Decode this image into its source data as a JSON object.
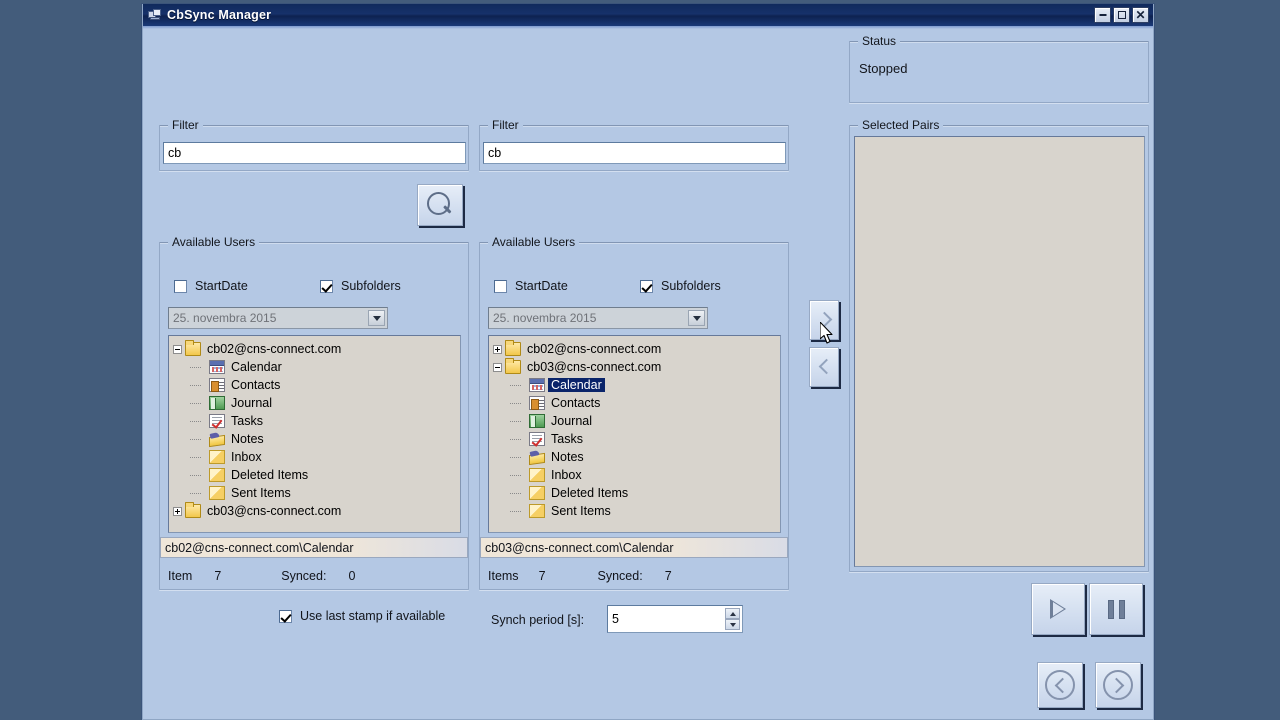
{
  "window": {
    "title": "CbSync Manager",
    "icon": "app-icon",
    "buttons": {
      "minimize": "_",
      "maximize": "□",
      "close": "✕"
    }
  },
  "status": {
    "legend": "Status",
    "value": "Stopped"
  },
  "selected_pairs": {
    "legend": "Selected Pairs",
    "items": []
  },
  "left_panel": {
    "filter": {
      "legend": "Filter",
      "value": "cb",
      "placeholder": ""
    },
    "users": {
      "legend": "Available Users",
      "startdate_label": "StartDate",
      "startdate_checked": false,
      "subfolders_label": "Subfolders",
      "subfolders_checked": true,
      "date_value": "25. novembra 2015",
      "date_enabled": false
    },
    "tree": [
      {
        "label": "cb02@cns-connect.com",
        "icon": "folder-icon",
        "level": 0,
        "expander": "minus",
        "selected": false
      },
      {
        "label": "Calendar",
        "icon": "calendar-icon",
        "level": 1,
        "expander": "none",
        "selected": false
      },
      {
        "label": "Contacts",
        "icon": "contacts-icon",
        "level": 1,
        "expander": "none",
        "selected": false
      },
      {
        "label": "Journal",
        "icon": "journal-icon",
        "level": 1,
        "expander": "none",
        "selected": false
      },
      {
        "label": "Tasks",
        "icon": "tasks-icon",
        "level": 1,
        "expander": "none",
        "selected": false
      },
      {
        "label": "Notes",
        "icon": "notes-icon",
        "level": 1,
        "expander": "none",
        "selected": false
      },
      {
        "label": "Inbox",
        "icon": "folder2-icon",
        "level": 1,
        "expander": "none",
        "selected": false
      },
      {
        "label": "Deleted Items",
        "icon": "folder2-icon",
        "level": 1,
        "expander": "none",
        "selected": false
      },
      {
        "label": "Sent Items",
        "icon": "folder2-icon",
        "level": 1,
        "expander": "none",
        "selected": false
      },
      {
        "label": "cb03@cns-connect.com",
        "icon": "folder-icon",
        "level": 0,
        "expander": "plus",
        "selected": false
      }
    ],
    "path": "cb02@cns-connect.com\\Calendar",
    "count_label": "Item",
    "count_value": "7",
    "synced_label": "Synced:",
    "synced_value": "0"
  },
  "right_panel": {
    "filter": {
      "legend": "Filter",
      "value": "cb",
      "placeholder": ""
    },
    "users": {
      "legend": "Available Users",
      "startdate_label": "StartDate",
      "startdate_checked": false,
      "subfolders_label": "Subfolders",
      "subfolders_checked": true,
      "date_value": "25. novembra 2015",
      "date_enabled": false
    },
    "tree": [
      {
        "label": "cb02@cns-connect.com",
        "icon": "folder-icon",
        "level": 0,
        "expander": "plus",
        "selected": false
      },
      {
        "label": "cb03@cns-connect.com",
        "icon": "folder-icon",
        "level": 0,
        "expander": "minus",
        "selected": false
      },
      {
        "label": "Calendar",
        "icon": "calendar-icon",
        "level": 1,
        "expander": "none",
        "selected": true
      },
      {
        "label": "Contacts",
        "icon": "contacts-icon",
        "level": 1,
        "expander": "none",
        "selected": false
      },
      {
        "label": "Journal",
        "icon": "journal-icon",
        "level": 1,
        "expander": "none",
        "selected": false
      },
      {
        "label": "Tasks",
        "icon": "tasks-icon",
        "level": 1,
        "expander": "none",
        "selected": false
      },
      {
        "label": "Notes",
        "icon": "notes-icon",
        "level": 1,
        "expander": "none",
        "selected": false
      },
      {
        "label": "Inbox",
        "icon": "folder2-icon",
        "level": 1,
        "expander": "none",
        "selected": false
      },
      {
        "label": "Deleted Items",
        "icon": "folder2-icon",
        "level": 1,
        "expander": "none",
        "selected": false
      },
      {
        "label": "Sent Items",
        "icon": "folder2-icon",
        "level": 1,
        "expander": "none",
        "selected": false
      }
    ],
    "path": "cb03@cns-connect.com\\Calendar",
    "count_label": "Items",
    "count_value": "7",
    "synced_label": "Synced:",
    "synced_value": "7"
  },
  "transfer": {
    "add_icon": "chevron-right-icon",
    "remove_icon": "chevron-left-icon"
  },
  "search_button": {
    "icon": "magnifier-icon"
  },
  "bottom": {
    "use_last_stamp_label": "Use last stamp if available",
    "use_last_stamp_checked": true,
    "synch_period_label": "Synch period [s]:",
    "synch_period_value": "5"
  },
  "transport": {
    "play": "play-icon",
    "pause": "pause-icon",
    "previous": "previous-icon",
    "next": "next-icon"
  },
  "colors": {
    "window_bg": "#b4c8e4",
    "titlebar": "#12306a",
    "desktop": "#435c7b",
    "tree_bg": "#d8d4cd",
    "selection": "#0a246a",
    "path_bar": "#efe6d9"
  }
}
